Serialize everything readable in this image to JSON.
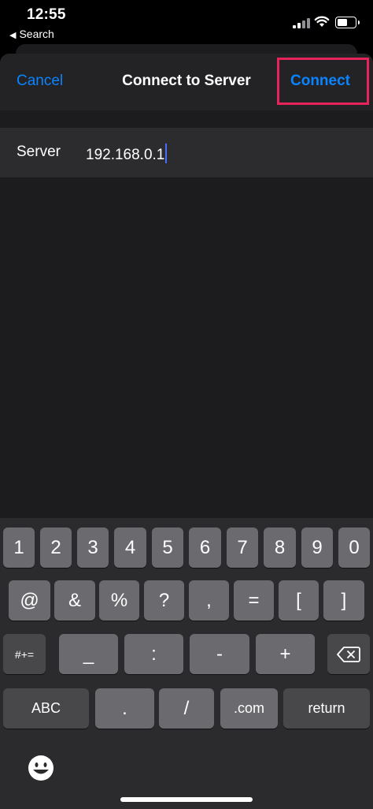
{
  "status_bar": {
    "time": "12:55",
    "back_app": "Search",
    "back_arrow": "◀"
  },
  "navbar": {
    "cancel_label": "Cancel",
    "title": "Connect to Server",
    "connect_label": "Connect",
    "accent_color": "#0a84ff",
    "highlight_color": "#e8225a"
  },
  "form": {
    "server_label": "Server",
    "server_value": "192.168.0.1"
  },
  "keyboard": {
    "row1": [
      "1",
      "2",
      "3",
      "4",
      "5",
      "6",
      "7",
      "8",
      "9",
      "0"
    ],
    "row2": [
      "@",
      "&",
      "%",
      "?",
      ",",
      "=",
      "[",
      "]"
    ],
    "row3": [
      "#+=",
      "_",
      ":",
      "-",
      "+"
    ],
    "row4": [
      "ABC",
      ".",
      "/",
      ".com",
      "return"
    ],
    "icons": [
      "delete-icon",
      "emoji-icon"
    ]
  }
}
